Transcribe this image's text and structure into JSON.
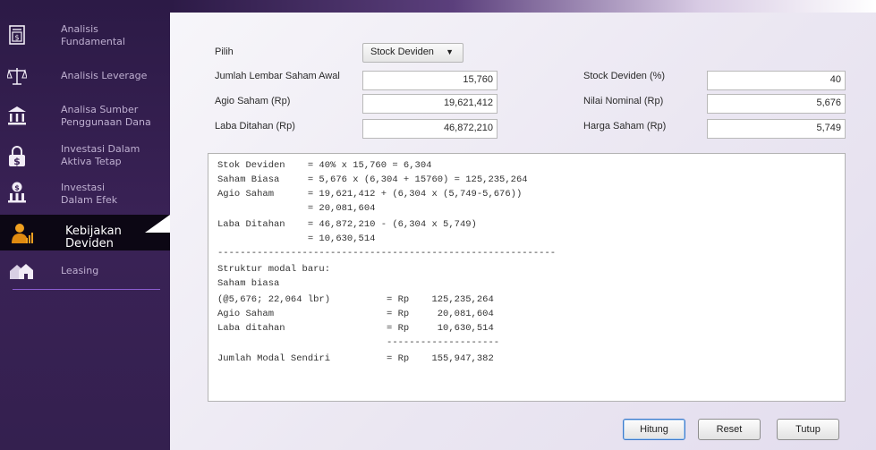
{
  "sidebar": {
    "items": [
      {
        "label": "Analisis Fundamental",
        "icon": "document-icon"
      },
      {
        "label": "Analisis Leverage",
        "icon": "scale-icon"
      },
      {
        "label": "Analisa Sumber Penggunaan Dana",
        "icon": "bank-icon"
      },
      {
        "label": "Investasi Dalam Aktiva Tetap",
        "icon": "lock-dollar-icon"
      },
      {
        "label": "Investasi Dalam Efek",
        "icon": "bank-coin-icon"
      },
      {
        "label": "Kebijakan Deviden",
        "icon": "person-chart-icon"
      },
      {
        "label": "Leasing",
        "icon": "houses-icon"
      }
    ]
  },
  "form": {
    "pilih_label": "Pilih",
    "pilih_value": "Stock Deviden",
    "jumlah_lembar_label": "Jumlah Lembar Saham Awal",
    "jumlah_lembar_value": "15,760",
    "agio_label": "Agio Saham (Rp)",
    "agio_value": "19,621,412",
    "laba_label": "Laba Ditahan (Rp)",
    "laba_value": "46,872,210",
    "stock_dev_label": "Stock Deviden (%)",
    "stock_dev_value": "40",
    "nominal_label": "Nilai Nominal (Rp)",
    "nominal_value": "5,676",
    "harga_label": "Harga Saham (Rp)",
    "harga_value": "5,749"
  },
  "output_lines": [
    "Stok Deviden    = 40% x 15,760 = 6,304",
    "Saham Biasa     = 5,676 x (6,304 + 15760) = 125,235,264",
    "Agio Saham      = 19,621,412 + (6,304 x (5,749-5,676))",
    "                = 20,081,604",
    "Laba Ditahan    = 46,872,210 - (6,304 x 5,749)",
    "                = 10,630,514",
    "------------------------------------------------------------",
    "Struktur modal baru:",
    "Saham biasa",
    "(@5,676; 22,064 lbr)          = Rp    125,235,264",
    "Agio Saham                    = Rp     20,081,604",
    "Laba ditahan                  = Rp     10,630,514",
    "                              --------------------",
    "Jumlah Modal Sendiri          = Rp    155,947,382"
  ],
  "buttons": {
    "hitung": "Hitung",
    "reset": "Reset",
    "tutup": "Tutup"
  }
}
